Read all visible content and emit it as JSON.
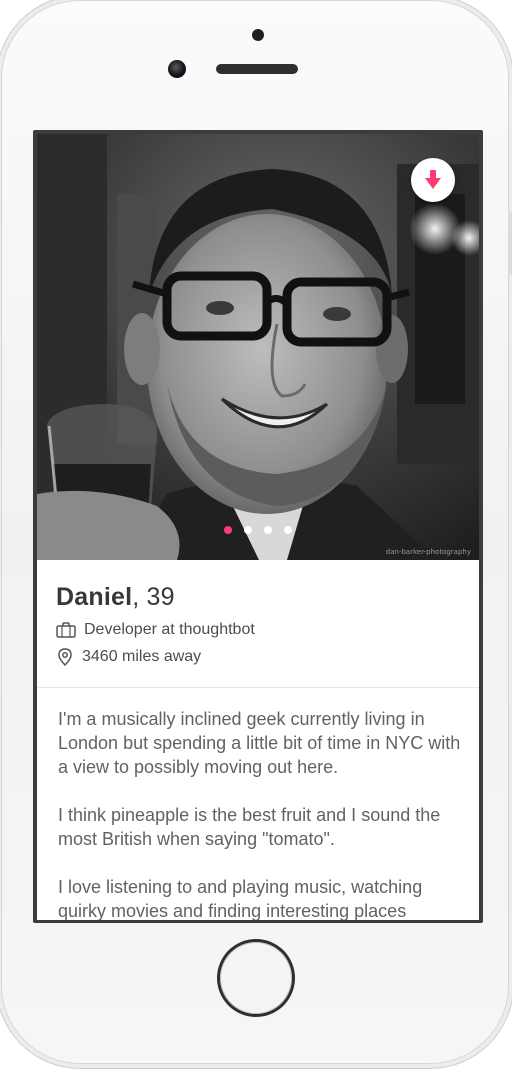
{
  "profile": {
    "name": "Daniel",
    "age_text": ", 39",
    "job": "Developer at thoughtbot",
    "distance": "3460 miles away"
  },
  "photo": {
    "credit": "dan-barker-photography",
    "current_index": 1,
    "total_photos": 4
  },
  "bio": {
    "p1": "I'm a musically inclined geek currently living in London but spending a little bit of time in NYC with a view to possibly moving out here.",
    "p2": "I think pineapple is the best fruit and I sound the most British when saying \"tomato\".",
    "p3": "I love listening to and playing music, watching quirky movies and finding interesting places"
  },
  "icons": {
    "collapse": "arrow-down-icon",
    "job": "briefcase-icon",
    "location": "location-pin-icon"
  },
  "colors": {
    "accent": "#fe3c72",
    "text_primary": "#383838",
    "text_secondary": "#626262"
  }
}
